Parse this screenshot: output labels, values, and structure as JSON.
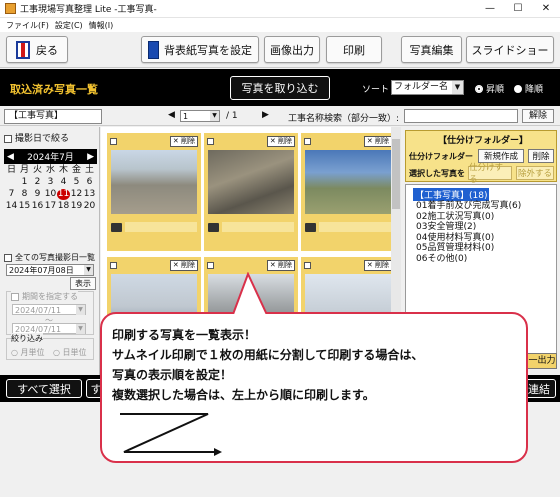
{
  "window": {
    "title": "工事現場写真整理 Lite -工事写真-",
    "controls": [
      "—",
      "☐",
      "✕"
    ]
  },
  "menu": [
    "ファイル(F)",
    "設定(C)",
    "情報(I)"
  ],
  "toolbar": {
    "back": "戻る",
    "background_setting": "背表紙写真を設定",
    "image_output": "画像出力",
    "print": "印刷",
    "photo_edit": "写真編集",
    "slideshow": "スライドショー"
  },
  "header": {
    "title": "取込済み写真一覧",
    "import_button": "写真を取り込む",
    "sort_label": "ソート",
    "sort_value": "フォルダー名",
    "order_asc": "昇順",
    "order_desc": "降順"
  },
  "paging": {
    "tab": "【工事写真】",
    "page": "1",
    "total": "/ 1",
    "search_label": "工事名称検索（部分一致）:",
    "search_value": "",
    "clear_button": "解除"
  },
  "filter": {
    "date_filter_label": "撮影日で絞る",
    "calendar_month": "2024年7月",
    "weekdays": [
      "日",
      "月",
      "火",
      "水",
      "木",
      "金",
      "土"
    ],
    "days": [
      "",
      "1",
      "2",
      "3",
      "4",
      "5",
      "6",
      "7",
      "8",
      "9",
      "10",
      "11",
      "12",
      "13",
      "14",
      "15",
      "16",
      "17",
      "18",
      "19",
      "20"
    ],
    "selected_day": "11",
    "all_dates_label": "全ての写真撮影日一覧",
    "date_value": "2024年07月08日",
    "show_button": "表示",
    "period_label": "期間を指定する",
    "period_from": "2024/07/11",
    "period_tilde": "〜",
    "period_to": "2024/07/11",
    "narrow_label": "絞り込み",
    "month_unit": "月単位",
    "day_unit": "日単位"
  },
  "photos": [
    {
      "delete_label": "✕ 削除"
    },
    {
      "delete_label": "✕ 削除"
    },
    {
      "delete_label": "✕ 削除"
    },
    {
      "delete_label": "✕ 削除"
    },
    {
      "delete_label": "✕ 削除"
    },
    {
      "delete_label": "✕ 削除"
    }
  ],
  "folder_panel": {
    "title": "【仕分けフォルダー】",
    "folder_label": "仕分けフォルダー",
    "new_button": "新規作成",
    "delete_button": "削除",
    "selected_label": "選択した写真を",
    "sort_button": "仕分けする",
    "exclude_button": "除外する",
    "tree": [
      "【工事写真】(18)",
      "01着手前及び完成写真(6)",
      "02施工状況写真(0)",
      "03安全管理(2)",
      "04使用材料写真(0)",
      "05品質管理材料(0)",
      "06その他(0)"
    ],
    "output_button": "一出力"
  },
  "bottom": {
    "select_all": "すべて選択",
    "second_button": "す",
    "right_button": "連結"
  },
  "callout": {
    "lines": [
      "印刷する写真を一覧表示！",
      "サムネイル印刷で１枚の用紙に分割して印刷する場合は、",
      "写真の表示順を設定！",
      "複数選択した場合は、左上から順に印刷します。"
    ]
  },
  "colors": {
    "accent_yellow": "#f2d36b",
    "header_black": "#000000",
    "callout_border": "#d9304a",
    "tree_selected": "#1f60d0"
  }
}
